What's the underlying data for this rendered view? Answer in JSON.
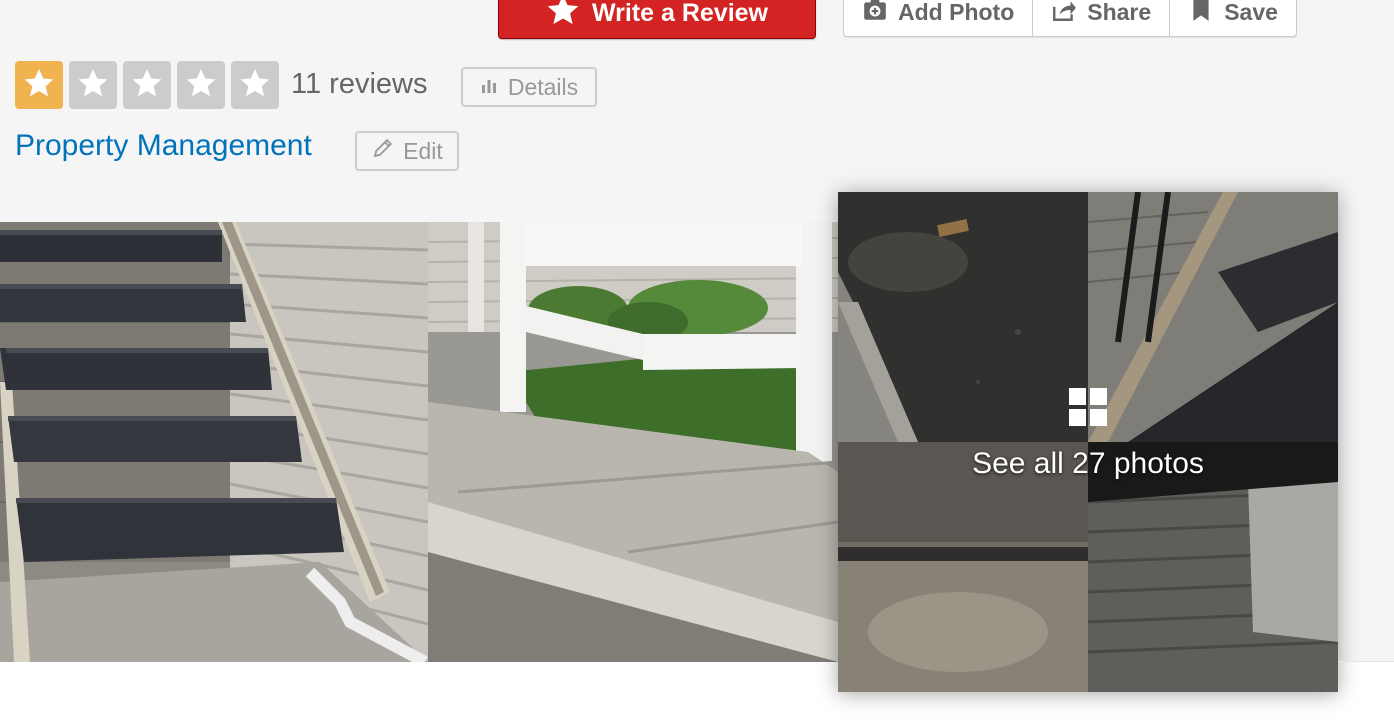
{
  "actions": {
    "write_review_label": "Write a Review",
    "add_photo_label": "Add Photo",
    "share_label": "Share",
    "save_label": "Save",
    "brand_red": "#d32323"
  },
  "rating": {
    "stars": 1,
    "max_stars": 5,
    "star_on_color": "#f0b34f",
    "star_off_color": "#cccccc",
    "review_count_label": "11 reviews",
    "details_label": "Details"
  },
  "category": {
    "label": "Property Management",
    "edit_label": "Edit",
    "link_color": "#0073bb"
  },
  "photos": {
    "see_all_label": "See all 27 photos"
  }
}
